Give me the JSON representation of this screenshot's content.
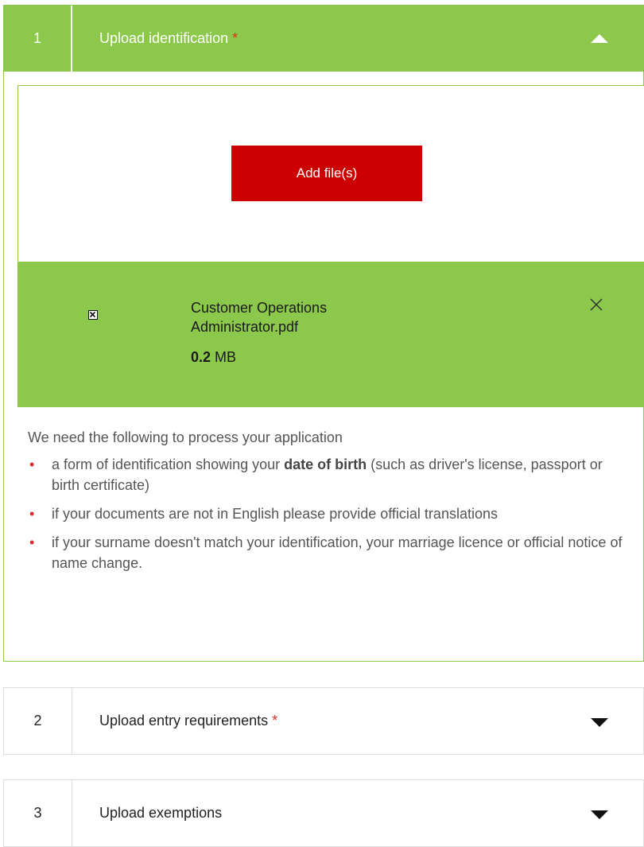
{
  "sections": [
    {
      "number": "1",
      "title": "Upload identification",
      "required_mark": "*",
      "toggle_icon": "chevron-up-icon"
    },
    {
      "number": "2",
      "title": "Upload entry requirements",
      "required_mark": "*",
      "toggle_icon": "chevron-down-icon"
    },
    {
      "number": "3",
      "title": "Upload exemptions",
      "toggle_icon": "chevron-down-icon"
    }
  ],
  "upload": {
    "button_label": "Add file(s)",
    "file": {
      "name": "Customer Operations Administrator.pdf",
      "size_value": "0.2",
      "size_unit": "MB",
      "icon": "file-icon",
      "remove_icon": "close-icon"
    }
  },
  "info": {
    "lead": "We need the following to process your application",
    "items": [
      {
        "pre": "a form of identification showing your ",
        "bold": "date of birth",
        "post": " (such as driver's license, passport or birth certificate)"
      },
      {
        "text": "if your documents are not in English please provide official translations"
      },
      {
        "text": "if your surname doesn't match your identification, your marriage licence or official notice of name change."
      }
    ]
  },
  "colors": {
    "header_green": "#8cc84b",
    "button_red": "#cc0000",
    "required_red": "#d32f2f"
  }
}
